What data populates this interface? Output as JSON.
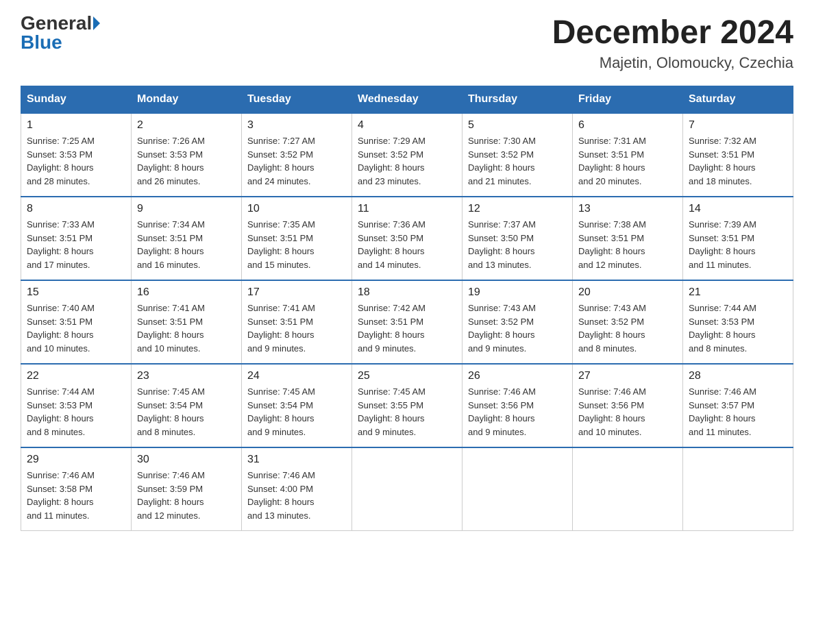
{
  "header": {
    "logo_general": "General",
    "logo_blue": "Blue",
    "main_title": "December 2024",
    "sub_title": "Majetin, Olomoucky, Czechia"
  },
  "days_of_week": [
    "Sunday",
    "Monday",
    "Tuesday",
    "Wednesday",
    "Thursday",
    "Friday",
    "Saturday"
  ],
  "weeks": [
    [
      {
        "day": "1",
        "info": "Sunrise: 7:25 AM\nSunset: 3:53 PM\nDaylight: 8 hours\nand 28 minutes."
      },
      {
        "day": "2",
        "info": "Sunrise: 7:26 AM\nSunset: 3:53 PM\nDaylight: 8 hours\nand 26 minutes."
      },
      {
        "day": "3",
        "info": "Sunrise: 7:27 AM\nSunset: 3:52 PM\nDaylight: 8 hours\nand 24 minutes."
      },
      {
        "day": "4",
        "info": "Sunrise: 7:29 AM\nSunset: 3:52 PM\nDaylight: 8 hours\nand 23 minutes."
      },
      {
        "day": "5",
        "info": "Sunrise: 7:30 AM\nSunset: 3:52 PM\nDaylight: 8 hours\nand 21 minutes."
      },
      {
        "day": "6",
        "info": "Sunrise: 7:31 AM\nSunset: 3:51 PM\nDaylight: 8 hours\nand 20 minutes."
      },
      {
        "day": "7",
        "info": "Sunrise: 7:32 AM\nSunset: 3:51 PM\nDaylight: 8 hours\nand 18 minutes."
      }
    ],
    [
      {
        "day": "8",
        "info": "Sunrise: 7:33 AM\nSunset: 3:51 PM\nDaylight: 8 hours\nand 17 minutes."
      },
      {
        "day": "9",
        "info": "Sunrise: 7:34 AM\nSunset: 3:51 PM\nDaylight: 8 hours\nand 16 minutes."
      },
      {
        "day": "10",
        "info": "Sunrise: 7:35 AM\nSunset: 3:51 PM\nDaylight: 8 hours\nand 15 minutes."
      },
      {
        "day": "11",
        "info": "Sunrise: 7:36 AM\nSunset: 3:50 PM\nDaylight: 8 hours\nand 14 minutes."
      },
      {
        "day": "12",
        "info": "Sunrise: 7:37 AM\nSunset: 3:50 PM\nDaylight: 8 hours\nand 13 minutes."
      },
      {
        "day": "13",
        "info": "Sunrise: 7:38 AM\nSunset: 3:51 PM\nDaylight: 8 hours\nand 12 minutes."
      },
      {
        "day": "14",
        "info": "Sunrise: 7:39 AM\nSunset: 3:51 PM\nDaylight: 8 hours\nand 11 minutes."
      }
    ],
    [
      {
        "day": "15",
        "info": "Sunrise: 7:40 AM\nSunset: 3:51 PM\nDaylight: 8 hours\nand 10 minutes."
      },
      {
        "day": "16",
        "info": "Sunrise: 7:41 AM\nSunset: 3:51 PM\nDaylight: 8 hours\nand 10 minutes."
      },
      {
        "day": "17",
        "info": "Sunrise: 7:41 AM\nSunset: 3:51 PM\nDaylight: 8 hours\nand 9 minutes."
      },
      {
        "day": "18",
        "info": "Sunrise: 7:42 AM\nSunset: 3:51 PM\nDaylight: 8 hours\nand 9 minutes."
      },
      {
        "day": "19",
        "info": "Sunrise: 7:43 AM\nSunset: 3:52 PM\nDaylight: 8 hours\nand 9 minutes."
      },
      {
        "day": "20",
        "info": "Sunrise: 7:43 AM\nSunset: 3:52 PM\nDaylight: 8 hours\nand 8 minutes."
      },
      {
        "day": "21",
        "info": "Sunrise: 7:44 AM\nSunset: 3:53 PM\nDaylight: 8 hours\nand 8 minutes."
      }
    ],
    [
      {
        "day": "22",
        "info": "Sunrise: 7:44 AM\nSunset: 3:53 PM\nDaylight: 8 hours\nand 8 minutes."
      },
      {
        "day": "23",
        "info": "Sunrise: 7:45 AM\nSunset: 3:54 PM\nDaylight: 8 hours\nand 8 minutes."
      },
      {
        "day": "24",
        "info": "Sunrise: 7:45 AM\nSunset: 3:54 PM\nDaylight: 8 hours\nand 9 minutes."
      },
      {
        "day": "25",
        "info": "Sunrise: 7:45 AM\nSunset: 3:55 PM\nDaylight: 8 hours\nand 9 minutes."
      },
      {
        "day": "26",
        "info": "Sunrise: 7:46 AM\nSunset: 3:56 PM\nDaylight: 8 hours\nand 9 minutes."
      },
      {
        "day": "27",
        "info": "Sunrise: 7:46 AM\nSunset: 3:56 PM\nDaylight: 8 hours\nand 10 minutes."
      },
      {
        "day": "28",
        "info": "Sunrise: 7:46 AM\nSunset: 3:57 PM\nDaylight: 8 hours\nand 11 minutes."
      }
    ],
    [
      {
        "day": "29",
        "info": "Sunrise: 7:46 AM\nSunset: 3:58 PM\nDaylight: 8 hours\nand 11 minutes."
      },
      {
        "day": "30",
        "info": "Sunrise: 7:46 AM\nSunset: 3:59 PM\nDaylight: 8 hours\nand 12 minutes."
      },
      {
        "day": "31",
        "info": "Sunrise: 7:46 AM\nSunset: 4:00 PM\nDaylight: 8 hours\nand 13 minutes."
      },
      null,
      null,
      null,
      null
    ]
  ]
}
